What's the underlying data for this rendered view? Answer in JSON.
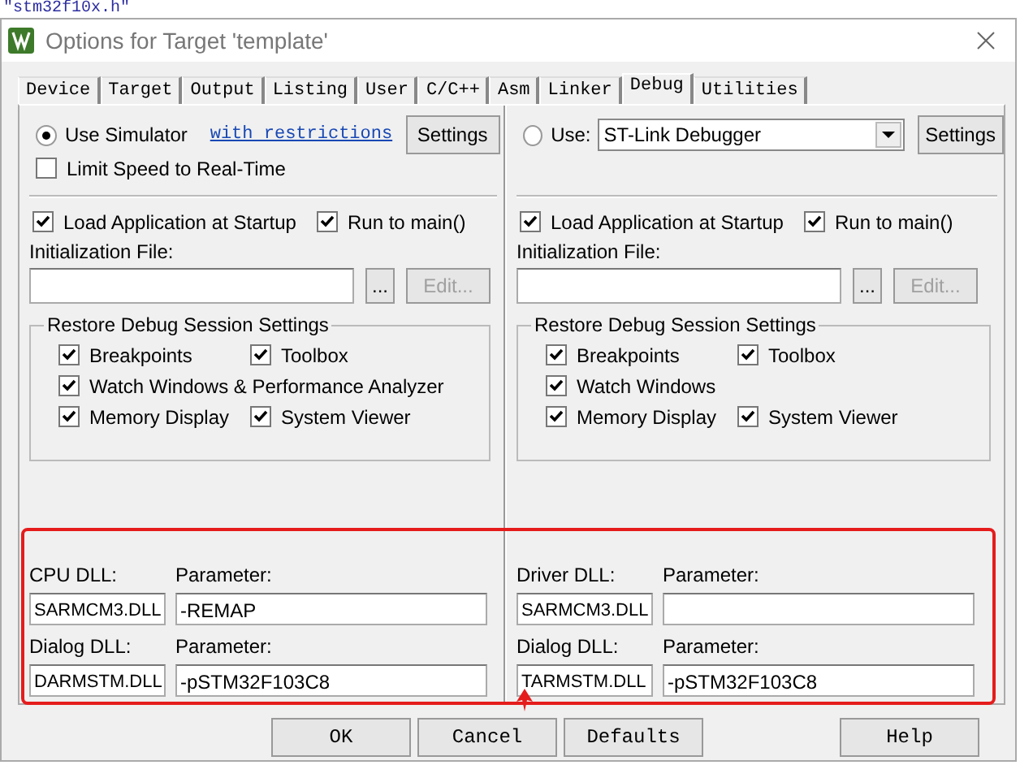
{
  "background_text": "\"stm32f10x.h\"",
  "window": {
    "title": "Options for Target 'template'"
  },
  "tabs": [
    {
      "label": "Device",
      "selected": false
    },
    {
      "label": "Target",
      "selected": false
    },
    {
      "label": "Output",
      "selected": false
    },
    {
      "label": "Listing",
      "selected": false
    },
    {
      "label": "User",
      "selected": false
    },
    {
      "label": "C/C++",
      "selected": false
    },
    {
      "label": "Asm",
      "selected": false
    },
    {
      "label": "Linker",
      "selected": false
    },
    {
      "label": "Debug",
      "selected": true
    },
    {
      "label": "Utilities",
      "selected": false
    }
  ],
  "panes": [
    {
      "kind": "simulator",
      "radio": {
        "label": "Use Simulator",
        "selected": true
      },
      "link": "with restrictions",
      "settings_button": "Settings",
      "limit_speed": {
        "label": "Limit Speed to Real-Time",
        "checked": false
      },
      "load_application": {
        "label": "Load Application at Startup",
        "checked": true
      },
      "run_to_main": {
        "label": "Run to main()",
        "checked": true
      },
      "init_file_label": "Initialization File:",
      "browse_button": "...",
      "edit_button": {
        "label": "Edit...",
        "disabled": true
      },
      "restore_group": {
        "title": "Restore Debug Session Settings",
        "rows": [
          [
            {
              "label": "Breakpoints",
              "checked": true
            },
            {
              "label": "Toolbox",
              "checked": true
            }
          ],
          [
            {
              "label": "Watch Windows & Performance Analyzer",
              "checked": true
            }
          ],
          [
            {
              "label": "Memory Display",
              "checked": true
            },
            {
              "label": "System Viewer",
              "checked": true
            }
          ]
        ]
      },
      "dlls": [
        {
          "dll_label": "CPU DLL:",
          "dll": "SARMCM3.DLL",
          "parameter_label": "Parameter:",
          "parameter": "-REMAP"
        },
        {
          "dll_label": "Dialog DLL:",
          "dll": "DARMSTM.DLL",
          "parameter_label": "Parameter:",
          "parameter": "-pSTM32F103C8"
        }
      ]
    },
    {
      "kind": "target",
      "radio": {
        "label": "Use:",
        "selected": false
      },
      "debugger": "ST-Link Debugger",
      "settings_button": "Settings",
      "load_application": {
        "label": "Load Application at Startup",
        "checked": true
      },
      "run_to_main": {
        "label": "Run to main()",
        "checked": true
      },
      "init_file_label": "Initialization File:",
      "browse_button": "...",
      "edit_button": {
        "label": "Edit...",
        "disabled": true
      },
      "restore_group": {
        "title": "Restore Debug Session Settings",
        "rows": [
          [
            {
              "label": "Breakpoints",
              "checked": true
            },
            {
              "label": "Toolbox",
              "checked": true
            }
          ],
          [
            {
              "label": "Watch Windows",
              "checked": true
            }
          ],
          [
            {
              "label": "Memory Display",
              "checked": true
            },
            {
              "label": "System Viewer",
              "checked": true
            }
          ]
        ]
      },
      "dlls": [
        {
          "dll_label": "Driver DLL:",
          "dll": "SARMCM3.DLL",
          "parameter_label": "Parameter:"
        },
        {
          "dll_label": "Dialog DLL:",
          "dll": "TARMSTM.DLL",
          "parameter_label": "Parameter:",
          "parameter": "-pSTM32F103C8"
        }
      ]
    }
  ],
  "buttons": [
    "OK",
    "Cancel",
    "Defaults",
    "Help"
  ]
}
